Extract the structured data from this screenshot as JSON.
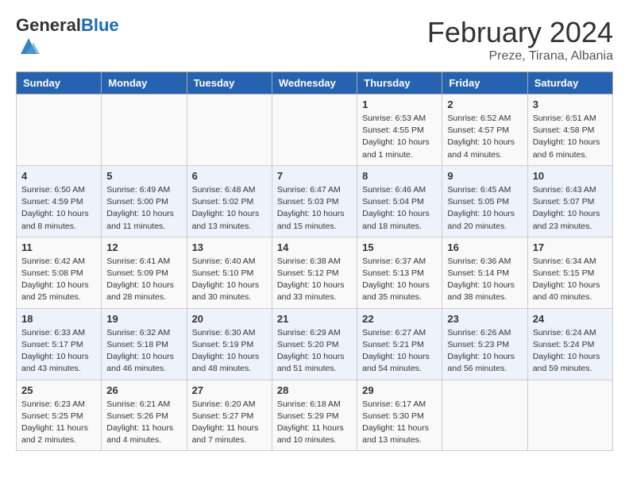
{
  "logo": {
    "general": "General",
    "blue": "Blue"
  },
  "header": {
    "month": "February 2024",
    "location": "Preze, Tirana, Albania"
  },
  "weekdays": [
    "Sunday",
    "Monday",
    "Tuesday",
    "Wednesday",
    "Thursday",
    "Friday",
    "Saturday"
  ],
  "weeks": [
    [
      {
        "day": "",
        "info": ""
      },
      {
        "day": "",
        "info": ""
      },
      {
        "day": "",
        "info": ""
      },
      {
        "day": "",
        "info": ""
      },
      {
        "day": "1",
        "info": "Sunrise: 6:53 AM\nSunset: 4:55 PM\nDaylight: 10 hours\nand 1 minute."
      },
      {
        "day": "2",
        "info": "Sunrise: 6:52 AM\nSunset: 4:57 PM\nDaylight: 10 hours\nand 4 minutes."
      },
      {
        "day": "3",
        "info": "Sunrise: 6:51 AM\nSunset: 4:58 PM\nDaylight: 10 hours\nand 6 minutes."
      }
    ],
    [
      {
        "day": "4",
        "info": "Sunrise: 6:50 AM\nSunset: 4:59 PM\nDaylight: 10 hours\nand 8 minutes."
      },
      {
        "day": "5",
        "info": "Sunrise: 6:49 AM\nSunset: 5:00 PM\nDaylight: 10 hours\nand 11 minutes."
      },
      {
        "day": "6",
        "info": "Sunrise: 6:48 AM\nSunset: 5:02 PM\nDaylight: 10 hours\nand 13 minutes."
      },
      {
        "day": "7",
        "info": "Sunrise: 6:47 AM\nSunset: 5:03 PM\nDaylight: 10 hours\nand 15 minutes."
      },
      {
        "day": "8",
        "info": "Sunrise: 6:46 AM\nSunset: 5:04 PM\nDaylight: 10 hours\nand 18 minutes."
      },
      {
        "day": "9",
        "info": "Sunrise: 6:45 AM\nSunset: 5:05 PM\nDaylight: 10 hours\nand 20 minutes."
      },
      {
        "day": "10",
        "info": "Sunrise: 6:43 AM\nSunset: 5:07 PM\nDaylight: 10 hours\nand 23 minutes."
      }
    ],
    [
      {
        "day": "11",
        "info": "Sunrise: 6:42 AM\nSunset: 5:08 PM\nDaylight: 10 hours\nand 25 minutes."
      },
      {
        "day": "12",
        "info": "Sunrise: 6:41 AM\nSunset: 5:09 PM\nDaylight: 10 hours\nand 28 minutes."
      },
      {
        "day": "13",
        "info": "Sunrise: 6:40 AM\nSunset: 5:10 PM\nDaylight: 10 hours\nand 30 minutes."
      },
      {
        "day": "14",
        "info": "Sunrise: 6:38 AM\nSunset: 5:12 PM\nDaylight: 10 hours\nand 33 minutes."
      },
      {
        "day": "15",
        "info": "Sunrise: 6:37 AM\nSunset: 5:13 PM\nDaylight: 10 hours\nand 35 minutes."
      },
      {
        "day": "16",
        "info": "Sunrise: 6:36 AM\nSunset: 5:14 PM\nDaylight: 10 hours\nand 38 minutes."
      },
      {
        "day": "17",
        "info": "Sunrise: 6:34 AM\nSunset: 5:15 PM\nDaylight: 10 hours\nand 40 minutes."
      }
    ],
    [
      {
        "day": "18",
        "info": "Sunrise: 6:33 AM\nSunset: 5:17 PM\nDaylight: 10 hours\nand 43 minutes."
      },
      {
        "day": "19",
        "info": "Sunrise: 6:32 AM\nSunset: 5:18 PM\nDaylight: 10 hours\nand 46 minutes."
      },
      {
        "day": "20",
        "info": "Sunrise: 6:30 AM\nSunset: 5:19 PM\nDaylight: 10 hours\nand 48 minutes."
      },
      {
        "day": "21",
        "info": "Sunrise: 6:29 AM\nSunset: 5:20 PM\nDaylight: 10 hours\nand 51 minutes."
      },
      {
        "day": "22",
        "info": "Sunrise: 6:27 AM\nSunset: 5:21 PM\nDaylight: 10 hours\nand 54 minutes."
      },
      {
        "day": "23",
        "info": "Sunrise: 6:26 AM\nSunset: 5:23 PM\nDaylight: 10 hours\nand 56 minutes."
      },
      {
        "day": "24",
        "info": "Sunrise: 6:24 AM\nSunset: 5:24 PM\nDaylight: 10 hours\nand 59 minutes."
      }
    ],
    [
      {
        "day": "25",
        "info": "Sunrise: 6:23 AM\nSunset: 5:25 PM\nDaylight: 11 hours\nand 2 minutes."
      },
      {
        "day": "26",
        "info": "Sunrise: 6:21 AM\nSunset: 5:26 PM\nDaylight: 11 hours\nand 4 minutes."
      },
      {
        "day": "27",
        "info": "Sunrise: 6:20 AM\nSunset: 5:27 PM\nDaylight: 11 hours\nand 7 minutes."
      },
      {
        "day": "28",
        "info": "Sunrise: 6:18 AM\nSunset: 5:29 PM\nDaylight: 11 hours\nand 10 minutes."
      },
      {
        "day": "29",
        "info": "Sunrise: 6:17 AM\nSunset: 5:30 PM\nDaylight: 11 hours\nand 13 minutes."
      },
      {
        "day": "",
        "info": ""
      },
      {
        "day": "",
        "info": ""
      }
    ]
  ]
}
